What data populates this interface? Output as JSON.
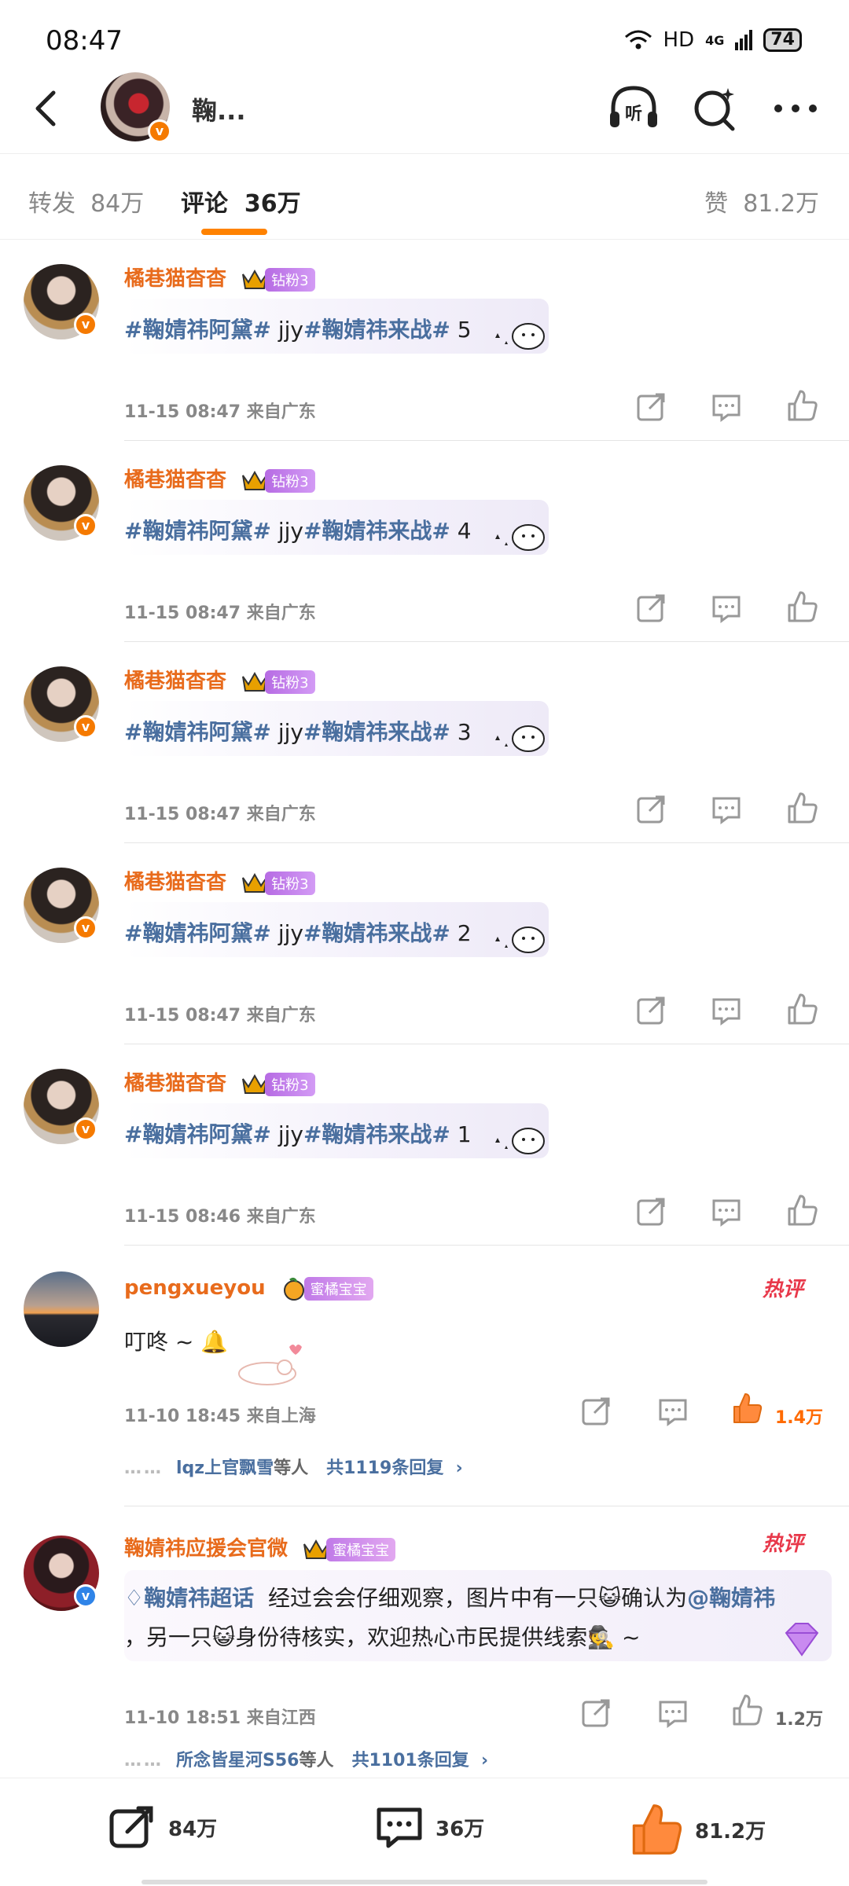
{
  "status_bar": {
    "time": "08:47",
    "network": "HD",
    "signal": "4G",
    "battery": "74"
  },
  "header": {
    "name": "鞠..."
  },
  "tabs": [
    {
      "label": "转发",
      "count": "84万"
    },
    {
      "label": "评论",
      "count": "36万"
    },
    {
      "label": "赞",
      "count": "81.2万"
    }
  ],
  "comments": [
    {
      "user": "橘巷猫杳杳",
      "fan_badge": "钻粉3",
      "tag1": "#鞠婧祎阿黛#",
      "mid": " jjy",
      "tag2": "#鞠婧祎来战#",
      "num": " 5",
      "time": "11-15 08:47 来自广东"
    },
    {
      "user": "橘巷猫杳杳",
      "fan_badge": "钻粉3",
      "tag1": "#鞠婧祎阿黛#",
      "mid": " jjy",
      "tag2": "#鞠婧祎来战#",
      "num": " 4",
      "time": "11-15 08:47 来自广东"
    },
    {
      "user": "橘巷猫杳杳",
      "fan_badge": "钻粉3",
      "tag1": "#鞠婧祎阿黛#",
      "mid": " jjy",
      "tag2": "#鞠婧祎来战#",
      "num": " 3",
      "time": "11-15 08:47 来自广东"
    },
    {
      "user": "橘巷猫杳杳",
      "fan_badge": "钻粉3",
      "tag1": "#鞠婧祎阿黛#",
      "mid": " jjy",
      "tag2": "#鞠婧祎来战#",
      "num": " 2",
      "time": "11-15 08:47 来自广东"
    },
    {
      "user": "橘巷猫杳杳",
      "fan_badge": "钻粉3",
      "tag1": "#鞠婧祎阿黛#",
      "mid": " jjy",
      "tag2": "#鞠婧祎来战#",
      "num": " 1",
      "time": "11-15 08:46 来自广东"
    }
  ],
  "hot_comments": [
    {
      "user": "pengxueyou",
      "fan_badge": "蜜橘宝宝",
      "hot_label": "热评",
      "text": "叮咚 ~ 🔔",
      "time": "11-10 18:45 来自上海",
      "likes": "1.4万",
      "reply_users": "lqz上官飘雪",
      "reply_suffix": "等人",
      "reply_total": "共1119条回复"
    },
    {
      "user": "鞠婧祎应援会官微",
      "fan_badge": "蜜橘宝宝",
      "hot_label": "热评",
      "topic": "鞠婧祎超话",
      "text_line1": "经过会会仔细观察，图片中有一只😺确认为",
      "mention": "@鞠婧祎",
      "text_line2": "，另一只😺身份待核实，欢迎热心市民提供线索🕵 ~",
      "time": "11-10 18:51 来自江西",
      "likes": "1.2万",
      "reply_users": "所念皆星河S56",
      "reply_suffix": "等人",
      "reply_total": "共1101条回复"
    }
  ],
  "footer": {
    "repost": "84万",
    "comment": "36万",
    "like": "81.2万"
  },
  "colors": {
    "accent": "#ff8200",
    "username": "#e86b1c",
    "topic": "#4a6f9f",
    "hot": "#e8384a"
  }
}
